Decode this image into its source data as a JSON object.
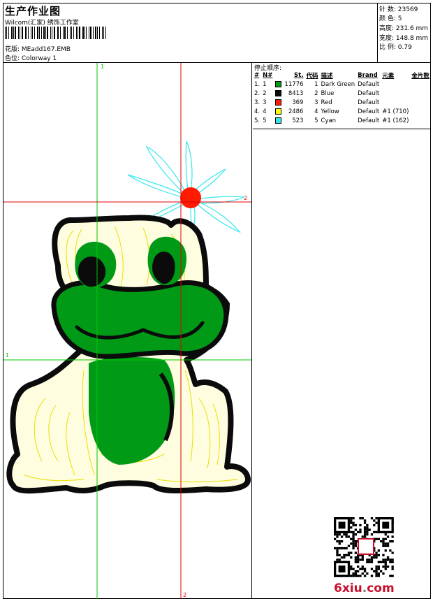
{
  "header": {
    "title": "生产作业图",
    "company": "Wilcom(汇家) 绣饰工作室",
    "design_label": "花版: ",
    "design_file": "MEadd167.EMB",
    "colorway_label": "色位: ",
    "colorway": "Colorway 1"
  },
  "info": [
    {
      "label": "针 数: ",
      "value": "23569"
    },
    {
      "label": "颜 色: ",
      "value": "5"
    },
    {
      "label": "高度: ",
      "value": "231.6 mm"
    },
    {
      "label": "宽度: ",
      "value": "148.8 mm"
    },
    {
      "label": "比 例: ",
      "value": "0.79"
    }
  ],
  "stops": {
    "title": "停止顺序:",
    "headers": [
      "#",
      "N#",
      "",
      "St.",
      "代码",
      "描述",
      "Brand",
      "元素",
      "金片数"
    ],
    "rows": [
      {
        "idx": "1.",
        "n": "1",
        "color": "#009a17",
        "st": "11776",
        "code": "1",
        "desc": "Dark Green",
        "brand": "Default",
        "elem": "",
        "sequin": ""
      },
      {
        "idx": "2.",
        "n": "2",
        "color": "#0b0b0b",
        "st": "8413",
        "code": "2",
        "desc": "Blue",
        "brand": "Default",
        "elem": "",
        "sequin": ""
      },
      {
        "idx": "3.",
        "n": "3",
        "color": "#ff1a00",
        "st": "369",
        "code": "3",
        "desc": "Red",
        "brand": "Default",
        "elem": "",
        "sequin": ""
      },
      {
        "idx": "4.",
        "n": "4",
        "color": "#ffff00",
        "st": "2486",
        "code": "4",
        "desc": "Yellow",
        "brand": "Default",
        "elem": "#1 (710)",
        "sequin": ""
      },
      {
        "idx": "5.",
        "n": "5",
        "color": "#33e7ef",
        "st": "523",
        "code": "5",
        "desc": "Cyan",
        "brand": "Default",
        "elem": "#1 (162)",
        "sequin": ""
      }
    ]
  },
  "guides": {
    "green_top": "1",
    "green_left": "1",
    "red_right": "2",
    "red_bottom": "2"
  },
  "watermark": {
    "pre": "6xiu",
    "dot": ".",
    "post": "com"
  },
  "colors": {
    "guide_green": "#00c800",
    "guide_red": "#e00000",
    "watermark": "#c8102e"
  }
}
